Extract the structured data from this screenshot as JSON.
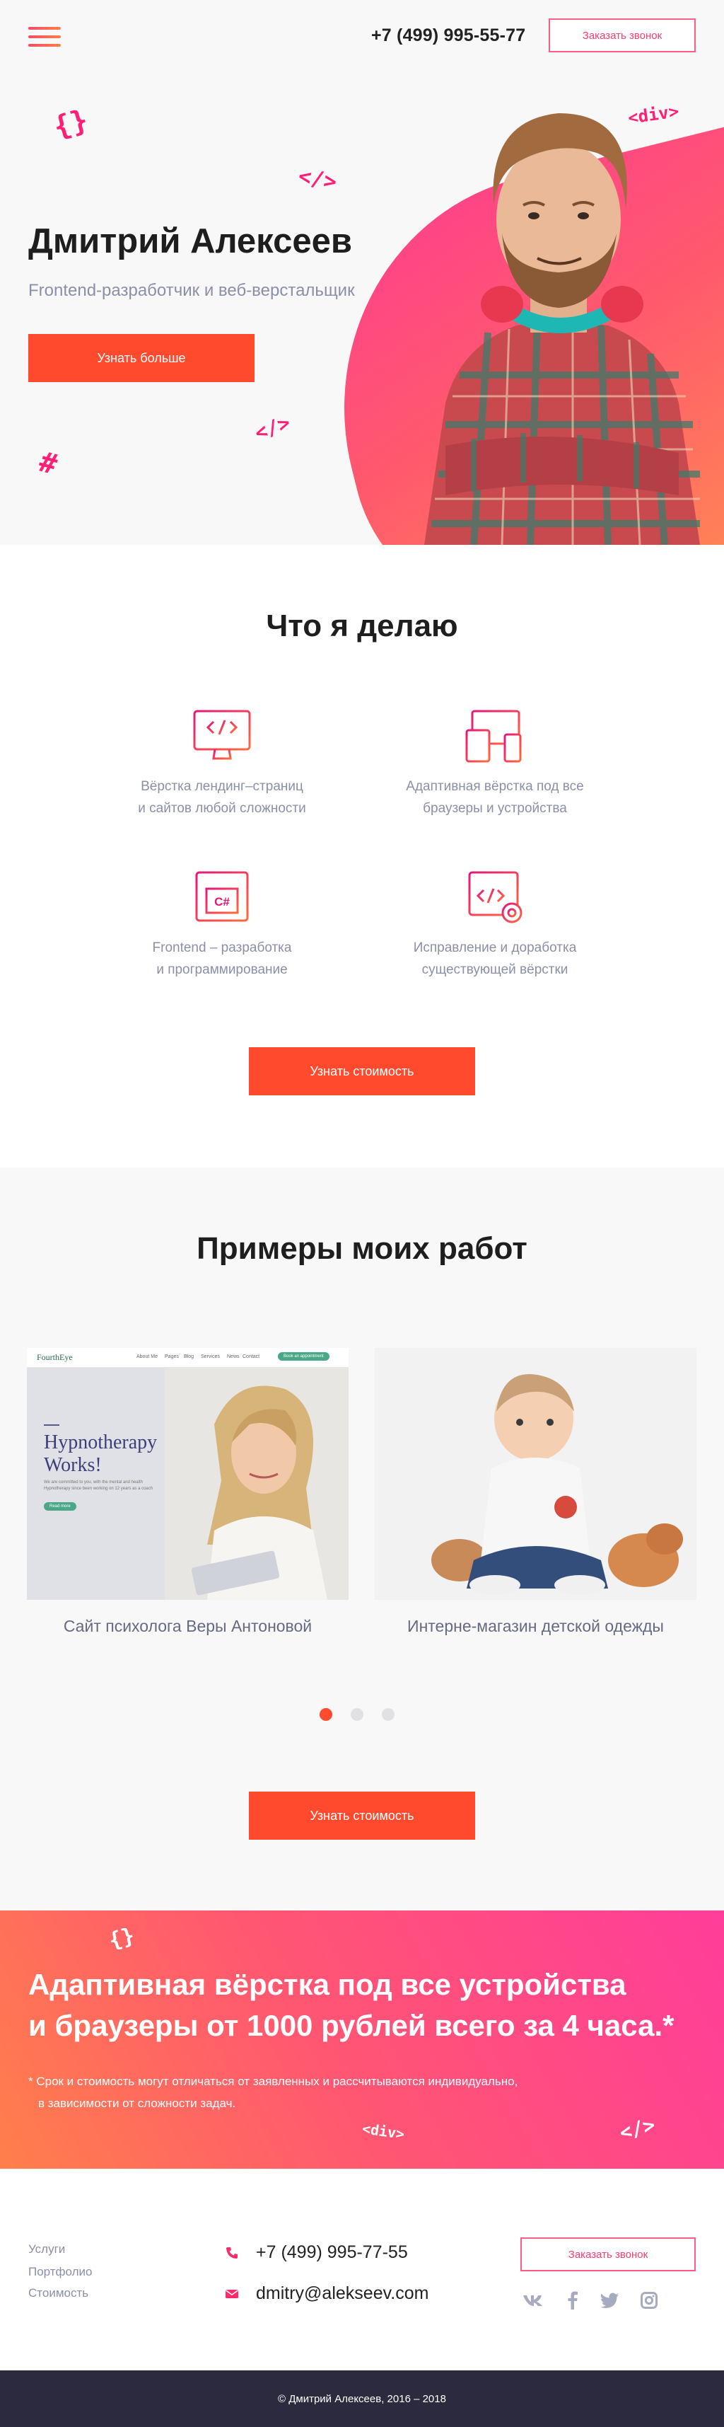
{
  "header": {
    "phone": "+7 (499) 995-55-77",
    "callback_label": "Заказать звонок"
  },
  "hero": {
    "title": "Дмитрий Алексеев",
    "subtitle": "Frontend-разработчик и веб-верстальщик",
    "cta_label": "Узнать больше",
    "deco": [
      "{}",
      "</>",
      "<div>",
      "</>",
      "#"
    ]
  },
  "services": {
    "title": "Что я делаю",
    "items": [
      {
        "icon": "code-monitor-icon",
        "line1": "Вёрстка лендинг–страниц",
        "line2": "и сайтов любой сложности"
      },
      {
        "icon": "devices-icon",
        "line1": "Адаптивная вёрстка под все",
        "line2": "браузеры и устройства"
      },
      {
        "icon": "csharp-window-icon",
        "line1": "Frontend – разработка",
        "line2": "и программирование"
      },
      {
        "icon": "code-settings-icon",
        "line1": "Исправление и доработка",
        "line2": "существующей вёрстки"
      }
    ],
    "cta_label": "Узнать стоимость"
  },
  "portfolio": {
    "title": "Примеры моих работ",
    "cards": [
      {
        "caption": "Сайт психолога Веры Антоновой",
        "preview": {
          "brand": "FourthEye",
          "nav": [
            "About Me",
            "Pages",
            "Blog",
            "Services",
            "News",
            "Contact"
          ],
          "nav_button": "Book an appointment",
          "headline1": "Hypnotherapy",
          "headline2": "Works!",
          "body": "We are committed to you, with the mental and health Hypnotherapy since been working on 12 years as a coach",
          "button": "Read more"
        }
      },
      {
        "caption": "Интерне-магазин детской одежды"
      }
    ],
    "active_slide": 1,
    "slide_count": 3,
    "cta_label": "Узнать стоимость"
  },
  "promo": {
    "line1": "Адаптивная вёрстка под все устройства",
    "line2": "и браузеры от 1000 рублей всего за 4 часа.*",
    "note1": "* Срок и стоимость могут отличаться от заявленных и рассчитываются  индивидуально,",
    "note2": "в зависимости от сложности задач.",
    "deco": [
      "{}",
      "<div>",
      "</>"
    ]
  },
  "footer": {
    "links": [
      "Услуги",
      "Портфолио",
      "Стоимость"
    ],
    "phone": "+7 (499) 995-77-55",
    "email": "dmitry@alekseev.com",
    "callback_label": "Заказать звонок",
    "social": [
      "vk-icon",
      "facebook-icon",
      "twitter-icon",
      "instagram-icon"
    ],
    "copyright": "© Дмитрий Алексеев, 2016 – 2018"
  },
  "colors": {
    "accent": "#ff4a2e",
    "pink": "#ff1f75",
    "text_muted": "#8b8fa8",
    "footer_bar": "#2c2a3e"
  }
}
